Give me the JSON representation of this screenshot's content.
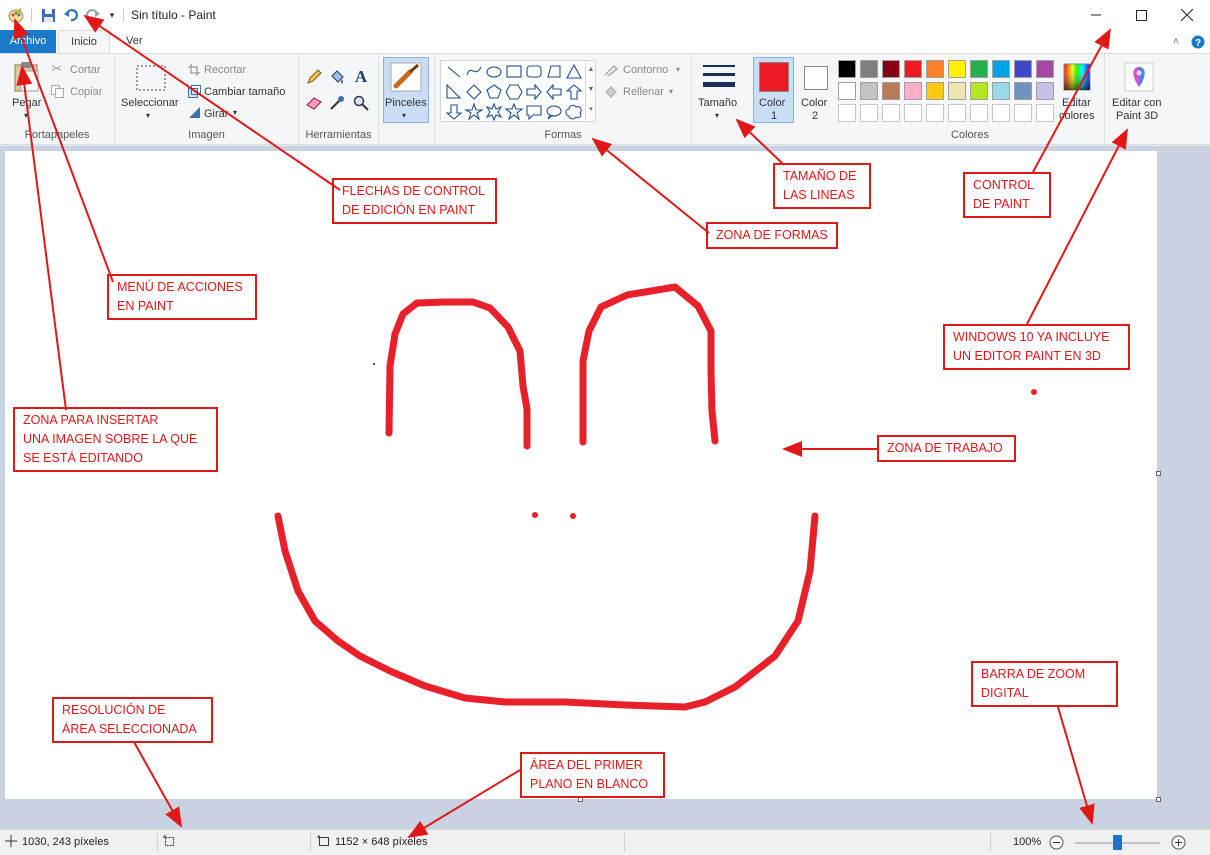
{
  "window": {
    "title": "Sin título - Paint"
  },
  "tabs": [
    {
      "label": "Archivo"
    },
    {
      "label": "Inicio"
    },
    {
      "label": "Ver"
    }
  ],
  "ribbon": {
    "portapapeles": {
      "title": "Portapapeles",
      "pegar": "Pegar",
      "cortar": "Cortar",
      "copiar": "Copiar"
    },
    "imagen": {
      "title": "Imagen",
      "seleccionar": "Seleccionar",
      "recortar": "Recortar",
      "cambiar_tamano": "Cambiar tamaño",
      "girar": "Girar"
    },
    "herramientas": {
      "title": "Herramientas",
      "pinceles": "Pinceles"
    },
    "formas": {
      "title": "Formas",
      "contorno": "Contorno",
      "rellenar": "Rellenar"
    },
    "tamano": "Tamaño",
    "color1": [
      "Color",
      "1"
    ],
    "color2": [
      "Color",
      "2"
    ],
    "colores": {
      "title": "Colores",
      "palette_row1": [
        "#000000",
        "#7f7f7f",
        "#880015",
        "#ed1c24",
        "#ff7f27",
        "#fff200",
        "#22b14c",
        "#00a2e8",
        "#3f48cc",
        "#a349a4"
      ],
      "palette_row2": [
        "#ffffff",
        "#c3c3c3",
        "#b97a57",
        "#ffaec9",
        "#ffc90e",
        "#efe4b0",
        "#b5e61d",
        "#99d9ea",
        "#7092be",
        "#c8bfe7"
      ],
      "editar_colores": [
        "Editar",
        "colores"
      ]
    },
    "paint3d": [
      "Editar con",
      "Paint 3D"
    ],
    "color1_value": "#ed1c24",
    "color2_value": "#ffffff"
  },
  "statusbar": {
    "cursor_pos": "1030, 243 píxeles",
    "canvas_size": "1152 × 648 píxeles",
    "zoom": "100%"
  },
  "annotations": {
    "flechas": "FLECHAS DE CONTROL\nDE EDICIÓN EN PAINT",
    "menu": "MENÚ DE ACCIONES\nEN PAINT",
    "insertar": "ZONA PARA INSERTAR\nUNA IMAGEN SOBRE LA QUE\nSE ESTÁ EDITANDO",
    "formas": "ZONA DE FORMAS",
    "tamano": "TAMAÑO DE\nLAS LINEAS",
    "control": "CONTROL\nDE PAINT",
    "windows10": "WINDOWS 10 YA INCLUYE\nUN EDITOR PAINT EN 3D",
    "trabajo": "ZONA DE TRABAJO",
    "resolucion": "RESOLUCIÓN DE\nÁREA SELECCIONADA",
    "area_blanco": "ÁREA DEL PRIMER\nPLANO EN BLANCO",
    "zoom": "BARRA DE ZOOM\nDIGITAL"
  },
  "colors": {
    "accent": "#1979ca",
    "annotation": "#e01818",
    "drawing": "#e8202a"
  }
}
